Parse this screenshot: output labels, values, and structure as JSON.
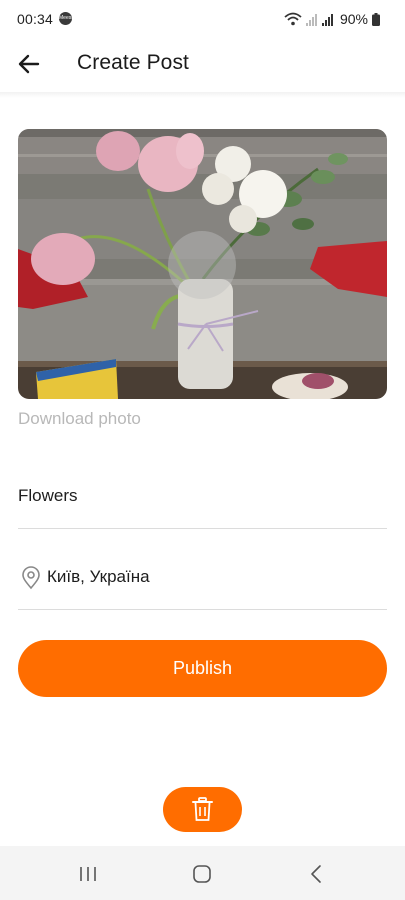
{
  "status_bar": {
    "time": "00:34",
    "notification_badge": "Meest",
    "battery": "90%"
  },
  "header": {
    "title": "Create Post",
    "back_icon": "arrow-left-icon"
  },
  "photo": {
    "alt": "Bouquet of tulips and white flowers in a knitted vase on a table",
    "download_label": "Download photo"
  },
  "form": {
    "title_value": "Flowers",
    "location_value": "Київ, Україна",
    "location_icon": "map-pin-icon"
  },
  "actions": {
    "publish_label": "Publish",
    "delete_icon": "trash-icon"
  },
  "colors": {
    "accent": "#ff6d00",
    "muted_text": "#b8b8b8",
    "divider": "#dcdcdc"
  },
  "nav_bar": {
    "recents_icon": "recents-icon",
    "home_icon": "home-icon",
    "back_icon": "back-chevron-icon"
  }
}
